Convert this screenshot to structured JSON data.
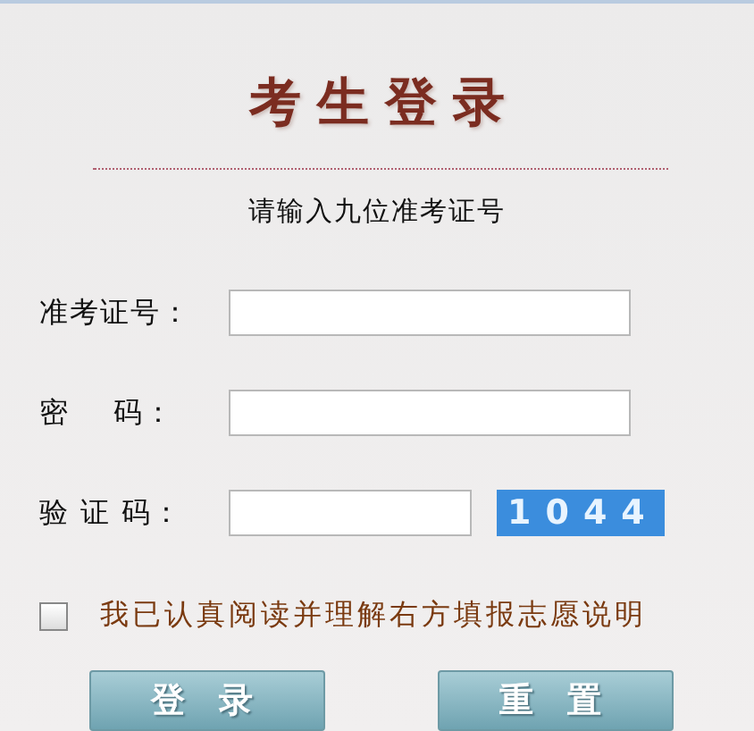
{
  "title": "考生登录",
  "subtitle": "请输入九位准考证号",
  "fields": [
    {
      "label": "准考证号：",
      "kind": "text"
    },
    {
      "label": "密    码：",
      "kind": "password"
    },
    {
      "label": "验 证 码：",
      "kind": "captcha",
      "captcha": "1044"
    }
  ],
  "agreement": {
    "label": "我已认真阅读并理解右方填报志愿说明",
    "checked": false
  },
  "buttons": [
    "登 录",
    "重 置"
  ]
}
